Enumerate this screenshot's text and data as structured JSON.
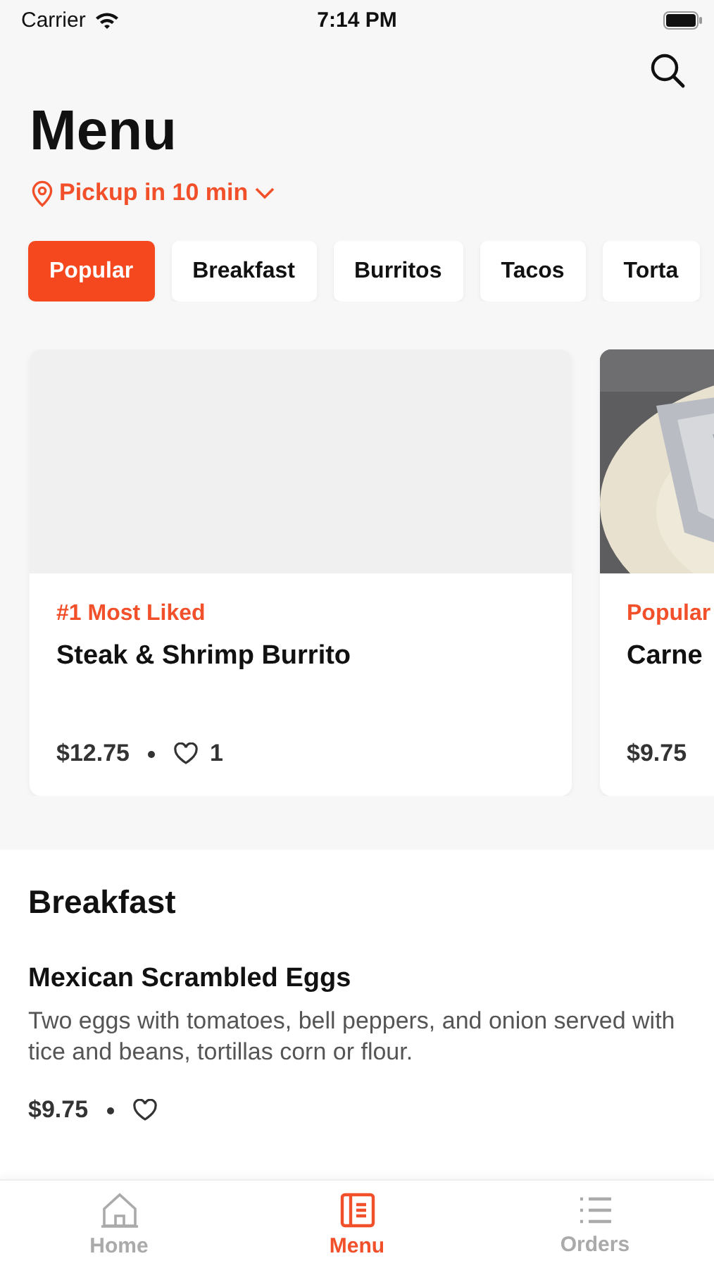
{
  "status_bar": {
    "carrier": "Carrier",
    "time": "7:14 PM"
  },
  "header": {
    "title": "Menu",
    "pickup": "Pickup in 10 min"
  },
  "categories": [
    {
      "label": "Popular",
      "selected": true
    },
    {
      "label": "Breakfast",
      "selected": false
    },
    {
      "label": "Burritos",
      "selected": false
    },
    {
      "label": "Tacos",
      "selected": false
    },
    {
      "label": "Torta",
      "selected": false
    }
  ],
  "featured": [
    {
      "image": {
        "kind": "placeholder"
      },
      "tag": "#1 Most Liked",
      "name": "Steak & Shrimp Burrito",
      "price": "$12.75",
      "likes": "1"
    },
    {
      "tag": "Popular",
      "name": "Carne",
      "price": "$9.75"
    }
  ],
  "section": {
    "title": "Breakfast",
    "items": [
      {
        "name": "Mexican Scrambled Eggs",
        "description": "Two eggs with tomatoes, bell peppers, and onion served with tice and beans, tortillas corn or flour.",
        "price": "$9.75"
      }
    ]
  },
  "tab_bar": [
    {
      "label": "Home",
      "kind": "home",
      "selected": false
    },
    {
      "label": "Menu",
      "kind": "menu",
      "selected": true
    },
    {
      "label": "Orders",
      "kind": "list",
      "selected": false
    }
  ]
}
